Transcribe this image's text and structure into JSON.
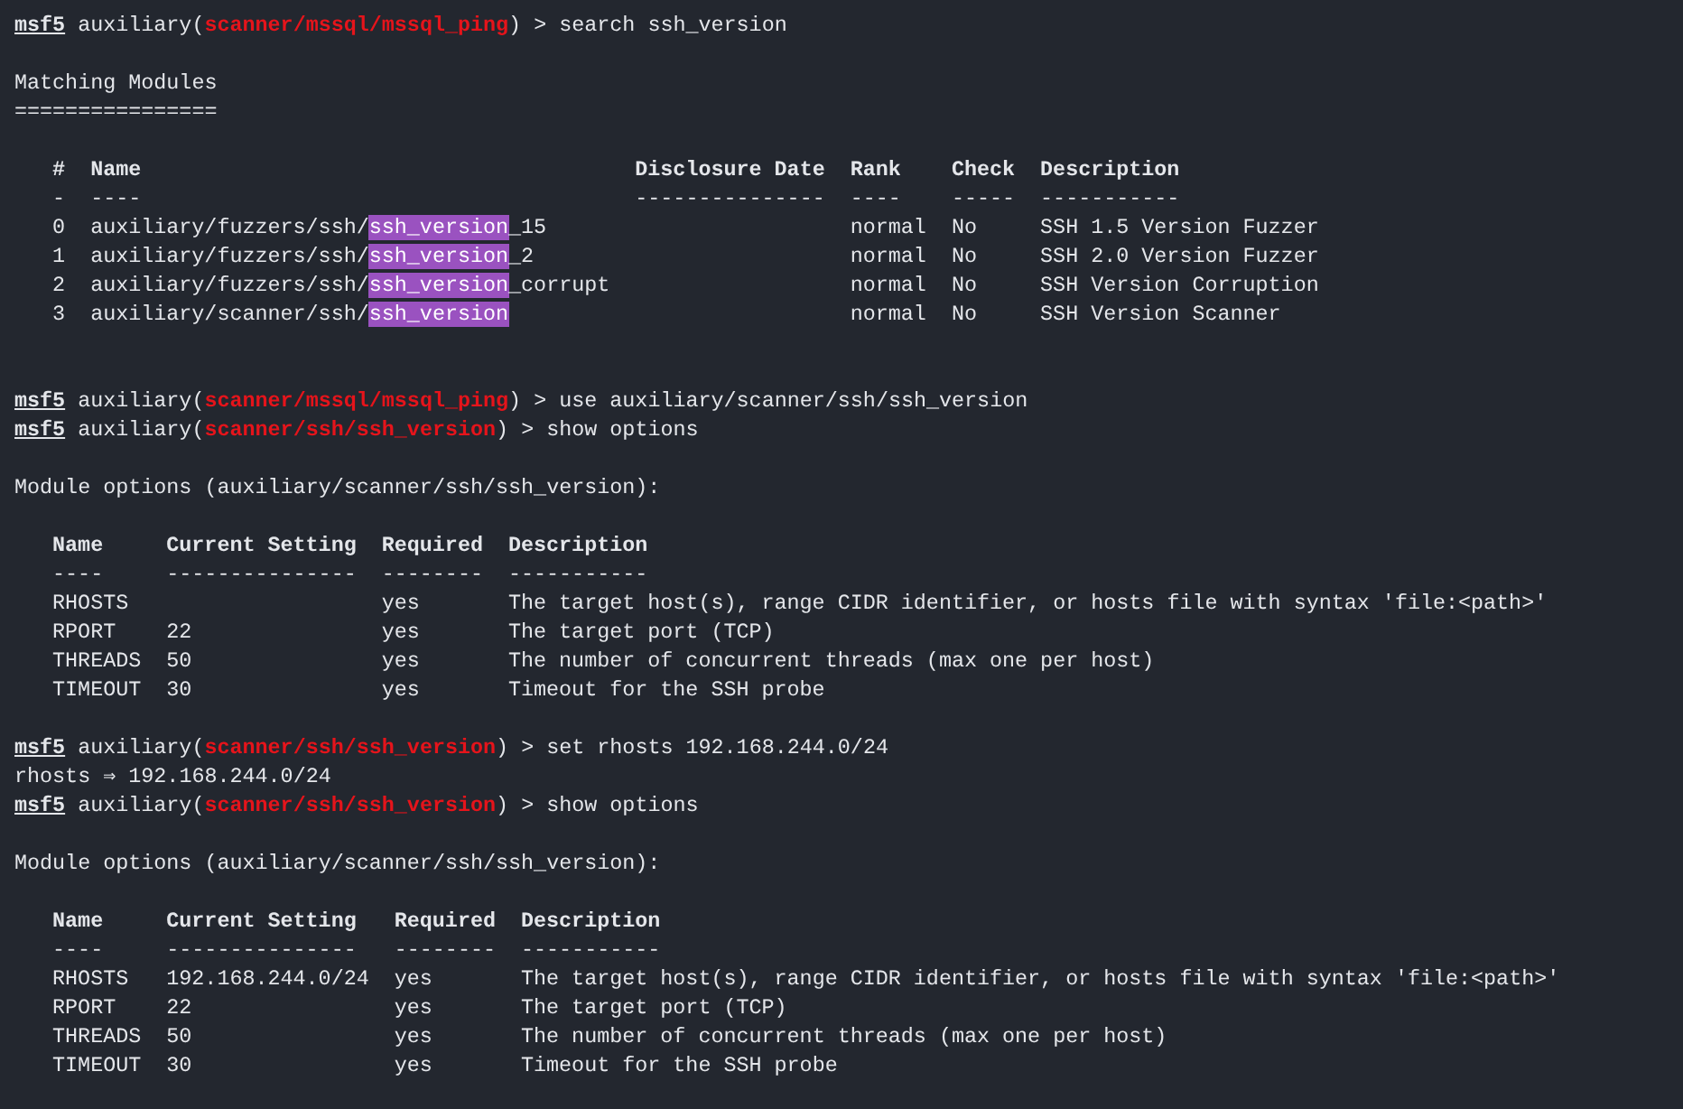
{
  "terminal": {
    "lines": [
      {
        "kind": "prompt",
        "parts": [
          {
            "kind": "prompt",
            "text": "msf5"
          },
          {
            "kind": "plain",
            "text": " auxiliary("
          },
          {
            "kind": "module",
            "text": "scanner/mssql/mssql_ping"
          },
          {
            "kind": "plain",
            "text": ") > search ssh_version"
          }
        ]
      },
      {
        "kind": "blank"
      },
      {
        "kind": "output",
        "text": "Matching Modules"
      },
      {
        "kind": "output",
        "text": "================"
      },
      {
        "kind": "blank"
      },
      {
        "kind": "table",
        "columns": [
          {
            "header": "#",
            "rule": "-"
          },
          {
            "header": "Name",
            "rule": "----"
          },
          {
            "header": "Disclosure Date",
            "rule": "---------------"
          },
          {
            "header": "Rank",
            "rule": "----"
          },
          {
            "header": "Check",
            "rule": "-----"
          },
          {
            "header": "Description",
            "rule": "-----------"
          }
        ],
        "rows": [
          {
            "cells": [
              "0",
              {
                "parts": [
                  {
                    "text": "auxiliary/fuzzers/ssh/",
                    "highlighted": false
                  },
                  {
                    "text": "ssh_version",
                    "highlighted": true
                  },
                  {
                    "text": "_15",
                    "highlighted": false
                  }
                ]
              },
              null,
              "normal",
              "No",
              "SSH 1.5 Version Fuzzer"
            ]
          },
          {
            "cells": [
              "1",
              {
                "parts": [
                  {
                    "text": "auxiliary/fuzzers/ssh/",
                    "highlighted": false
                  },
                  {
                    "text": "ssh_version",
                    "highlighted": true
                  },
                  {
                    "text": "_2",
                    "highlighted": false
                  }
                ]
              },
              null,
              "normal",
              "No",
              "SSH 2.0 Version Fuzzer"
            ]
          },
          {
            "cells": [
              "2",
              {
                "parts": [
                  {
                    "text": "auxiliary/fuzzers/ssh/",
                    "highlighted": false
                  },
                  {
                    "text": "ssh_version",
                    "highlighted": true
                  },
                  {
                    "text": "_corrupt",
                    "highlighted": false
                  }
                ]
              },
              null,
              "normal",
              "No",
              "SSH Version Corruption"
            ]
          },
          {
            "cells": [
              "3",
              {
                "parts": [
                  {
                    "text": "auxiliary/scanner/ssh/",
                    "highlighted": false
                  },
                  {
                    "text": "ssh_version",
                    "highlighted": true
                  }
                ]
              },
              null,
              "normal",
              "No",
              "SSH Version Scanner"
            ]
          }
        ]
      },
      {
        "kind": "blank"
      },
      {
        "kind": "blank"
      },
      {
        "kind": "prompt",
        "parts": [
          {
            "kind": "prompt",
            "text": "msf5"
          },
          {
            "kind": "plain",
            "text": " auxiliary("
          },
          {
            "kind": "module",
            "text": "scanner/mssql/mssql_ping"
          },
          {
            "kind": "plain",
            "text": ") > use auxiliary/scanner/ssh/ssh_version"
          }
        ]
      },
      {
        "kind": "prompt",
        "parts": [
          {
            "kind": "prompt",
            "text": "msf5"
          },
          {
            "kind": "plain",
            "text": " auxiliary("
          },
          {
            "kind": "module",
            "text": "scanner/ssh/ssh_version"
          },
          {
            "kind": "plain",
            "text": ") > show options"
          }
        ]
      },
      {
        "kind": "blank"
      },
      {
        "kind": "output",
        "text": "Module options (auxiliary/scanner/ssh/ssh_version):"
      },
      {
        "kind": "blank"
      },
      {
        "kind": "table",
        "columns": [
          {
            "header": "Name",
            "rule": "----"
          },
          {
            "header": "Current Setting",
            "rule": "---------------"
          },
          {
            "header": "Required",
            "rule": "--------"
          },
          {
            "header": "Description",
            "rule": "-----------"
          }
        ],
        "rows": [
          {
            "cells": [
              "RHOSTS",
              null,
              "yes",
              "The target host(s), range CIDR identifier, or hosts file with syntax 'file:<path>'"
            ]
          },
          {
            "cells": [
              "RPORT",
              "22",
              "yes",
              "The target port (TCP)"
            ]
          },
          {
            "cells": [
              "THREADS",
              "50",
              "yes",
              "The number of concurrent threads (max one per host)"
            ]
          },
          {
            "cells": [
              "TIMEOUT",
              "30",
              "yes",
              "Timeout for the SSH probe"
            ]
          }
        ]
      },
      {
        "kind": "blank"
      },
      {
        "kind": "prompt",
        "parts": [
          {
            "kind": "prompt",
            "text": "msf5"
          },
          {
            "kind": "plain",
            "text": " auxiliary("
          },
          {
            "kind": "module",
            "text": "scanner/ssh/ssh_version"
          },
          {
            "kind": "plain",
            "text": ") > set rhosts 192.168.244.0/24"
          }
        ]
      },
      {
        "kind": "output",
        "text": "rhosts ⇒ 192.168.244.0/24"
      },
      {
        "kind": "prompt",
        "parts": [
          {
            "kind": "prompt",
            "text": "msf5"
          },
          {
            "kind": "plain",
            "text": " auxiliary("
          },
          {
            "kind": "module",
            "text": "scanner/ssh/ssh_version"
          },
          {
            "kind": "plain",
            "text": ") > show options"
          }
        ]
      },
      {
        "kind": "blank"
      },
      {
        "kind": "output",
        "text": "Module options (auxiliary/scanner/ssh/ssh_version):"
      },
      {
        "kind": "blank"
      },
      {
        "kind": "table",
        "columns": [
          {
            "header": "Name",
            "rule": "----"
          },
          {
            "header": "Current Setting",
            "rule": "---------------"
          },
          {
            "header": "Required",
            "rule": "--------"
          },
          {
            "header": "Description",
            "rule": "-----------"
          }
        ],
        "rows": [
          {
            "cells": [
              "RHOSTS",
              "192.168.244.0/24",
              "yes",
              "The target host(s), range CIDR identifier, or hosts file with syntax 'file:<path>'"
            ]
          },
          {
            "cells": [
              "RPORT",
              "22",
              "yes",
              "The target port (TCP)"
            ]
          },
          {
            "cells": [
              "THREADS",
              "50",
              "yes",
              "The number of concurrent threads (max one per host)"
            ]
          },
          {
            "cells": [
              "TIMEOUT",
              "30",
              "yes",
              "Timeout for the SSH probe"
            ]
          }
        ]
      }
    ]
  }
}
